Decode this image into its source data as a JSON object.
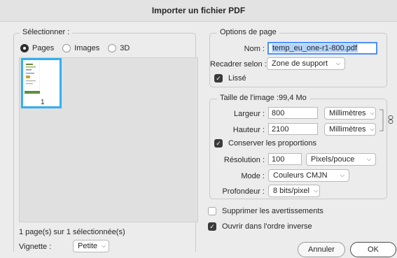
{
  "dialog": {
    "title": "Importer un fichier PDF"
  },
  "select_panel": {
    "legend": "Sélectionner :",
    "radios": [
      {
        "label": "Pages",
        "selected": true
      },
      {
        "label": "Images",
        "selected": false
      },
      {
        "label": "3D",
        "selected": false
      }
    ],
    "thumbnail_number": "1",
    "status": "1 page(s) sur 1 sélectionnée(s)",
    "vignette_label": "Vignette :",
    "vignette_value": "Petite"
  },
  "page_options": {
    "legend": "Options de page",
    "name_label": "Nom :",
    "name_value": "temp_eu_one-r1-800.pdf",
    "crop_label": "Recadrer selon :",
    "crop_value": "Zone de support",
    "smooth_label": "Lissé",
    "smooth_checked": true
  },
  "image_size": {
    "legend": "Taille de l'image :99,4 Mo",
    "width_label": "Largeur :",
    "width_value": "800",
    "width_unit": "Millimètres",
    "height_label": "Hauteur :",
    "height_value": "2100",
    "height_unit": "Millimètres",
    "constrain_label": "Conserver les proportions",
    "constrain_checked": true,
    "resolution_label": "Résolution :",
    "resolution_value": "100",
    "resolution_unit": "Pixels/pouce",
    "mode_label": "Mode :",
    "mode_value": "Couleurs CMJN",
    "depth_label": "Profondeur :",
    "depth_value": "8 bits/pixel"
  },
  "options": {
    "suppress_warnings_label": "Supprimer les avertissements",
    "suppress_warnings_checked": false,
    "reverse_order_label": "Ouvrir dans l'ordre inverse",
    "reverse_order_checked": true
  },
  "buttons": {
    "cancel": "Annuler",
    "ok": "OK"
  },
  "colors": {
    "accent": "#34aef0",
    "focus": "#4d90fe"
  }
}
